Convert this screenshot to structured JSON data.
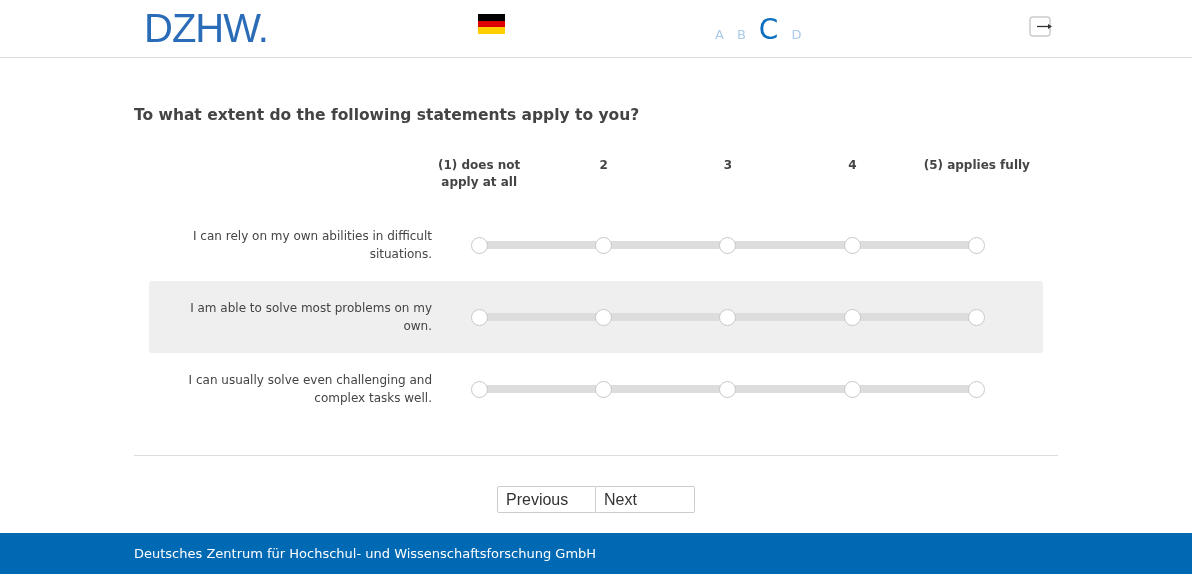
{
  "header": {
    "logo": "DZHW.",
    "sections": [
      {
        "label": "A",
        "selected": false
      },
      {
        "label": "B",
        "selected": false
      },
      {
        "label": "C",
        "selected": true
      },
      {
        "label": "D",
        "selected": false
      }
    ]
  },
  "question": "To what extent do the following statements apply to you?",
  "scale_labels": [
    "(1) does not apply at all",
    "2",
    "3",
    "4",
    "(5) applies fully"
  ],
  "items": [
    {
      "text": "I can rely on my own abilities in difficult situations.",
      "highlighted": false,
      "options": [
        {
          "selected": false
        },
        {
          "selected": false
        },
        {
          "selected": false
        },
        {
          "selected": false
        },
        {
          "selected": false
        }
      ]
    },
    {
      "text": "I am able to solve most problems on my own.",
      "highlighted": true,
      "options": [
        {
          "selected": false
        },
        {
          "selected": false
        },
        {
          "selected": false
        },
        {
          "selected": false
        },
        {
          "selected": false
        }
      ]
    },
    {
      "text": "I can usually solve even challenging and complex tasks well.",
      "highlighted": false,
      "options": [
        {
          "selected": false
        },
        {
          "selected": false
        },
        {
          "selected": false
        },
        {
          "selected": false
        },
        {
          "selected": false
        }
      ]
    }
  ],
  "buttons": [
    "Previous",
    "Next"
  ],
  "footer": "Deutsches Zentrum für Hochschul- und Wissenschaftsforschung GmbH"
}
